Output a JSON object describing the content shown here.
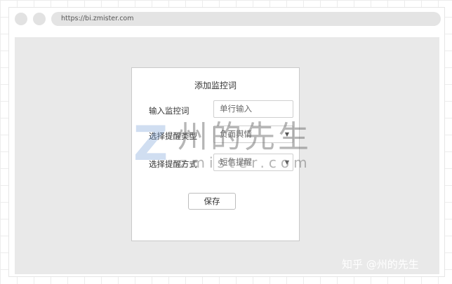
{
  "browser": {
    "url": "https://bi.zmister.com"
  },
  "dialog": {
    "title": "添加监控词",
    "keyword": {
      "label": "输入监控词",
      "placeholder": "单行输入"
    },
    "alert_type": {
      "label": "选择提醒类型",
      "value": "负面舆情"
    },
    "alert_method": {
      "label": "选择提醒方式",
      "value": "短信提醒"
    },
    "save_label": "保存"
  },
  "watermark": {
    "brand": "州的先生",
    "site": "zmister.com",
    "logo_letter": "Z",
    "credit": "知乎 @州的先生"
  }
}
